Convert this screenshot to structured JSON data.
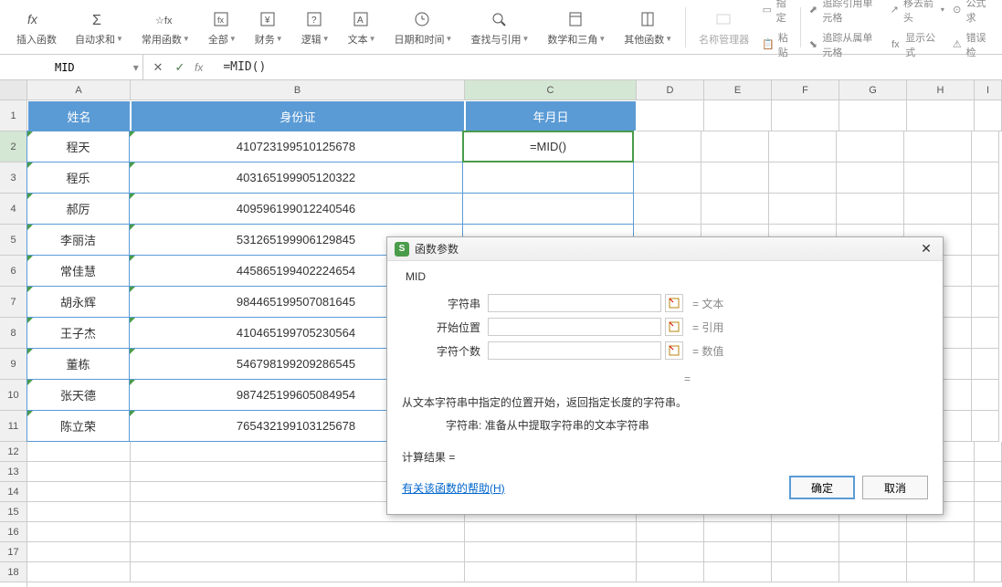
{
  "toolbar": {
    "insert_func": "插入函数",
    "auto_sum": "自动求和",
    "common_func": "常用函数",
    "all": "全部",
    "finance": "财务",
    "logic": "逻辑",
    "text": "文本",
    "datetime": "日期和时间",
    "lookup": "查找与引用",
    "math_trig": "数学和三角",
    "other_func": "其他函数",
    "name_mgr": "名称管理器",
    "paste": "粘贴",
    "define": "指定",
    "trace_ref": "追踪引用单元格",
    "trace_dep": "追踪从属单元格",
    "move_arrow": "移去箭头",
    "show_formula": "显示公式",
    "formula_eval": "公式求",
    "error_check": "错误检"
  },
  "formula_bar": {
    "name_box": "MID",
    "formula": "=MID()"
  },
  "columns": [
    "A",
    "B",
    "C",
    "D",
    "E",
    "F",
    "G",
    "H",
    "I"
  ],
  "rows": [
    "1",
    "2",
    "3",
    "4",
    "5",
    "6",
    "7",
    "8",
    "9",
    "10",
    "11",
    "12",
    "13",
    "14",
    "15",
    "16",
    "17",
    "18"
  ],
  "header_row": {
    "name": "姓名",
    "id": "身份证",
    "date": "年月日"
  },
  "data": [
    {
      "name": "程天",
      "id": "410723199510125678"
    },
    {
      "name": "程乐",
      "id": "403165199905120322"
    },
    {
      "name": "郝厉",
      "id": "409596199012240546"
    },
    {
      "name": "李丽洁",
      "id": "531265199906129845"
    },
    {
      "name": "常佳慧",
      "id": "445865199402224654"
    },
    {
      "name": "胡永辉",
      "id": "984465199507081645"
    },
    {
      "name": "王子杰",
      "id": "410465199705230564"
    },
    {
      "name": "董栋",
      "id": "546798199209286545"
    },
    {
      "name": "张天德",
      "id": "987425199605084954"
    },
    {
      "name": "陈立荣",
      "id": "765432199103125678"
    }
  ],
  "active_cell_value": "=MID()",
  "dialog": {
    "title": "函数参数",
    "func_name": "MID",
    "param1_label": "字符串",
    "param1_hint": "文本",
    "param2_label": "开始位置",
    "param2_hint": "引用",
    "param3_label": "字符个数",
    "param3_hint": "数值",
    "desc": "从文本字符串中指定的位置开始，返回指定长度的字符串。",
    "desc_sub_label": "字符串:",
    "desc_sub": "准备从中提取字符串的文本字符串",
    "calc_label": "计算结果 =",
    "help": "有关该函数的帮助(H)",
    "ok": "确定",
    "cancel": "取消"
  }
}
